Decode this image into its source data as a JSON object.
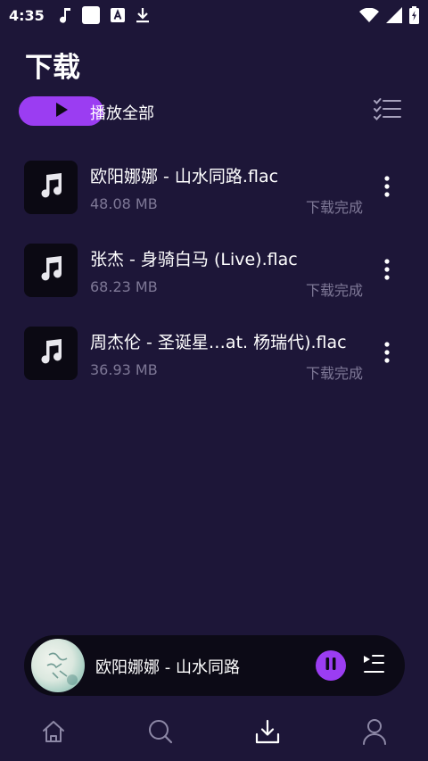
{
  "status_bar": {
    "time": "4:35",
    "left_icons": [
      "music-note-icon",
      "white-square-icon",
      "a-box-icon",
      "download-arrow-icon"
    ],
    "right_icons": [
      "wifi-icon",
      "signal-icon",
      "battery-charging-icon"
    ]
  },
  "page": {
    "title": "下载"
  },
  "toolbar": {
    "play_all_label": "播放全部",
    "accent_color": "#9b3df2"
  },
  "downloads": [
    {
      "title": "欧阳娜娜 - 山水同路.flac",
      "size": "48.08 MB",
      "status": "下载完成"
    },
    {
      "title": "张杰 - 身骑白马 (Live).flac",
      "size": "68.23 MB",
      "status": "下载完成"
    },
    {
      "title": "周杰伦 - 圣诞星…at. 杨瑞代).flac",
      "size": "36.93 MB",
      "status": "下载完成"
    }
  ],
  "mini_player": {
    "title": "欧阳娜娜 - 山水同路",
    "state": "playing"
  },
  "bottom_nav": {
    "items": [
      "home-icon",
      "search-icon",
      "download-icon",
      "profile-icon"
    ],
    "active": "download-icon"
  },
  "colors": {
    "background": "#1d1638",
    "secondary_text": "#7e7896"
  }
}
